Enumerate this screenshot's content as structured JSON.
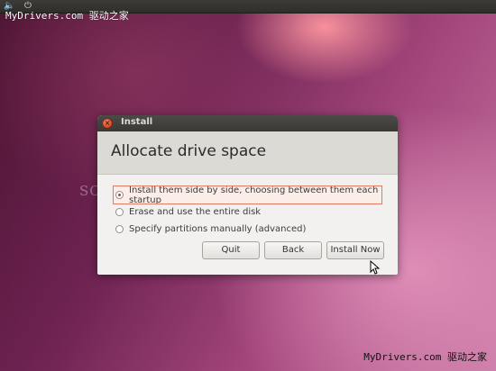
{
  "watermark": {
    "top_site": "MyDrivers.com",
    "top_cn": "驱动之家",
    "bottom_site": "MyDrivers.com",
    "bottom_cn": "驱动之家"
  },
  "panel": {
    "volume_icon": "volume-icon",
    "power_icon": "power-icon"
  },
  "window": {
    "title": "Install",
    "heading": "Allocate drive space",
    "options": [
      {
        "label": "Install them side by side, choosing between them each startup",
        "selected": true
      },
      {
        "label": "Erase and use the entire disk",
        "selected": false
      },
      {
        "label": "Specify partitions manually (advanced)",
        "selected": false
      }
    ],
    "buttons": {
      "quit": "Quit",
      "back": "Back",
      "install": "Install Now"
    }
  },
  "ghost_text": "SOFTPEDIA",
  "colors": {
    "accent": "#d9441f",
    "titlebar": "#3a3935",
    "header_band": "#dcdad5",
    "window_bg": "#f2f1f0"
  }
}
